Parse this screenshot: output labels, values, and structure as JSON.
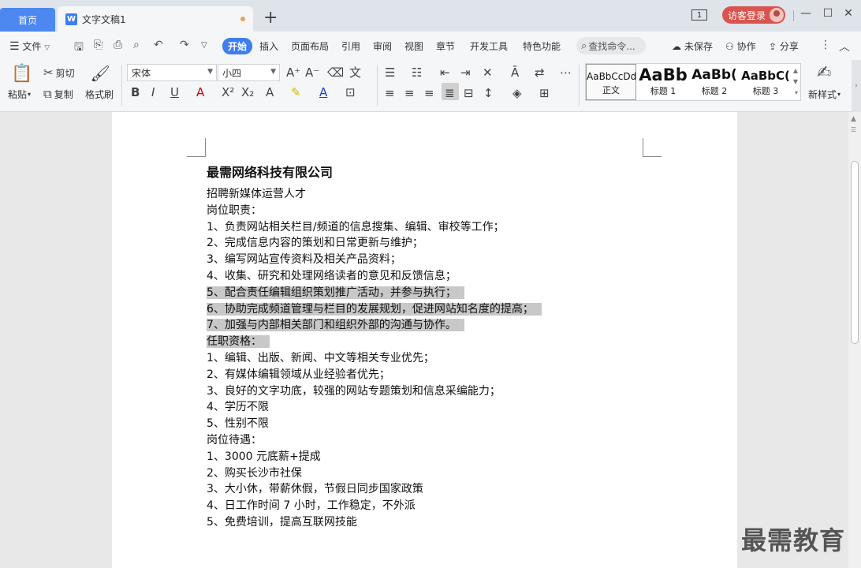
{
  "tabs": {
    "home": "首页",
    "doc": "文字文稿1"
  },
  "title_bar": {
    "page_badge": "1",
    "login": "访客登录"
  },
  "menu": {
    "file": "文件",
    "items": [
      "开始",
      "插入",
      "页面布局",
      "引用",
      "审阅",
      "视图",
      "章节",
      "开发工具",
      "特色功能"
    ],
    "search": "查找命令...",
    "unsaved": "未保存",
    "collab": "协作",
    "share": "分享"
  },
  "ribbon": {
    "paste": "粘贴",
    "cut": "剪切",
    "copy": "复制",
    "format_painter": "格式刷",
    "font_name": "宋体",
    "font_size": "小四",
    "styles": [
      {
        "sample": "AaBbCcDd",
        "name": "正文"
      },
      {
        "sample": "AaBb",
        "name": "标题 1"
      },
      {
        "sample": "AaBb(",
        "name": "标题 2"
      },
      {
        "sample": "AaBbC(",
        "name": "标题 3"
      }
    ],
    "new_style": "新样式"
  },
  "document": {
    "title": "最需网络科技有限公司",
    "lines": [
      "招聘新媒体运营人才",
      "岗位职责：",
      "1、负责网站相关栏目/频道的信息搜集、编辑、审校等工作；",
      "2、完成信息内容的策划和日常更新与维护；",
      "3、编写网站宣传资料及相关产品资料；",
      "4、收集、研究和处理网络读者的意见和反馈信息；",
      "5、配合责任编辑组织策划推广活动，并参与执行；",
      "6、协助完成频道管理与栏目的发展规划，促进网站知名度的提高；",
      "7、加强与内部相关部门和组织外部的沟通与协作。",
      "任职资格：",
      "1、编辑、出版、新闻、中文等相关专业优先；",
      "2、有媒体编辑领域从业经验者优先；",
      "3、良好的文字功底，较强的网站专题策划和信息采编能力；",
      "4、学历不限",
      "5、性别不限",
      "岗位待遇：",
      "1、3000 元底薪+提成",
      "2、购买长沙市社保",
      "3、大小休，带薪休假，节假日同步国家政策",
      "4、日工作时间 7 小时，工作稳定，不外派",
      "5、免费培训，提高互联网技能"
    ]
  },
  "watermark": "最需教育"
}
